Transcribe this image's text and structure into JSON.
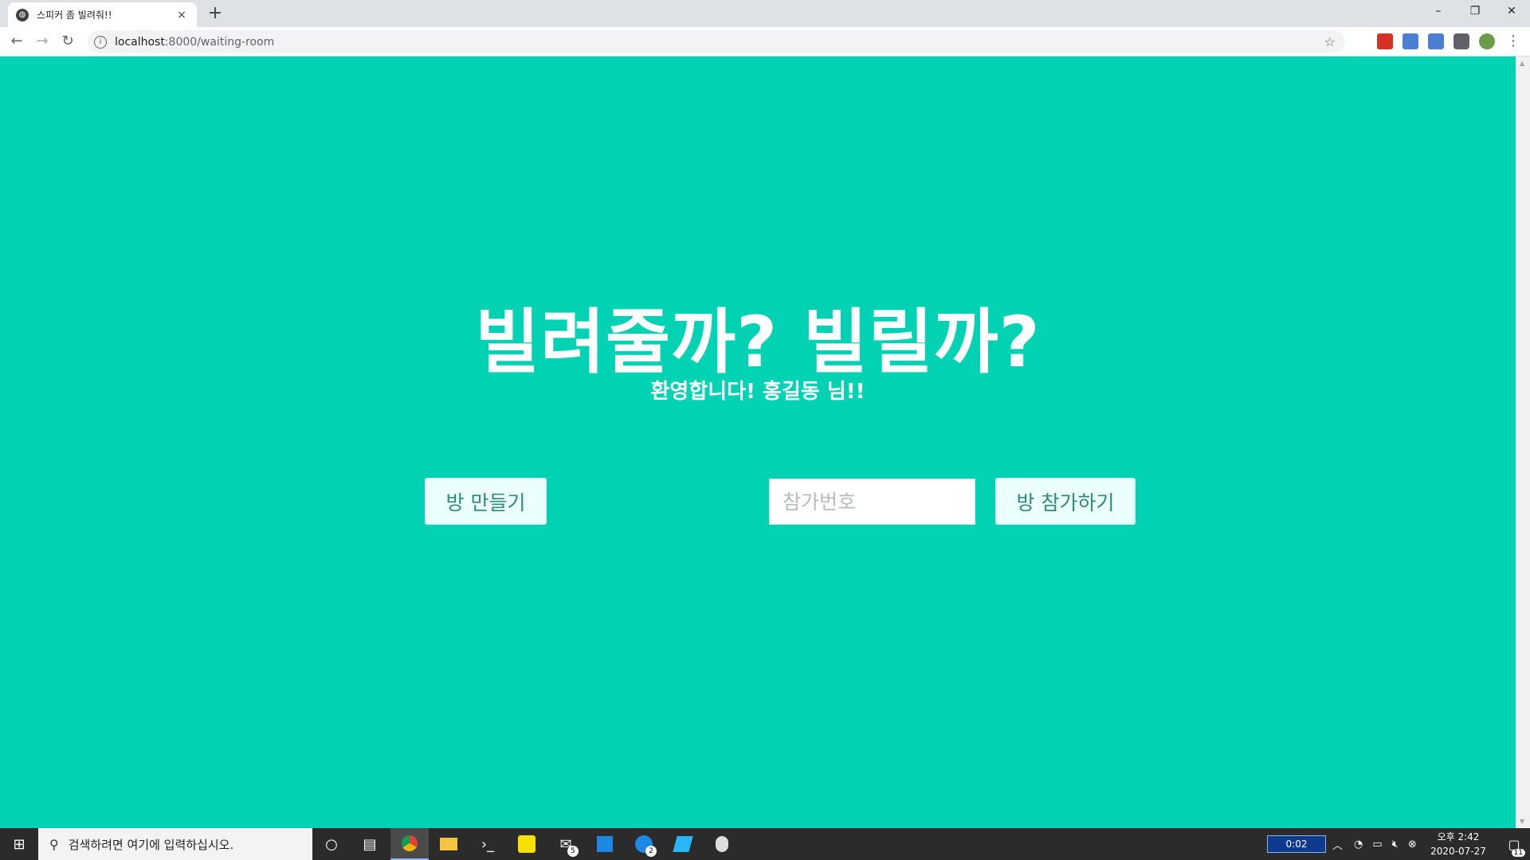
{
  "browser": {
    "tab_title": "스피커 좀 빌려줘!!",
    "tab_close": "×",
    "new_tab": "+",
    "url_host": "localhost",
    "url_path": ":8000/waiting-room",
    "window_controls": {
      "minimize": "–",
      "maximize": "❐",
      "close": "✕"
    }
  },
  "page": {
    "background": "#00d2b3",
    "headline": "빌려줄까? 빌릴까?",
    "welcome": "환영합니다! 홍길동 님!!",
    "create_room_label": "방 만들기",
    "room_code_placeholder": "참가번호",
    "join_room_label": "방 참가하기"
  },
  "taskbar": {
    "search_placeholder": "검색하려면 여기에 입력하십시오.",
    "timer": "0:02",
    "clock_time": "오후 2:42",
    "clock_date": "2020-07-27",
    "mail_badge": "5",
    "messenger_badge": "2",
    "notification_count": "11"
  }
}
